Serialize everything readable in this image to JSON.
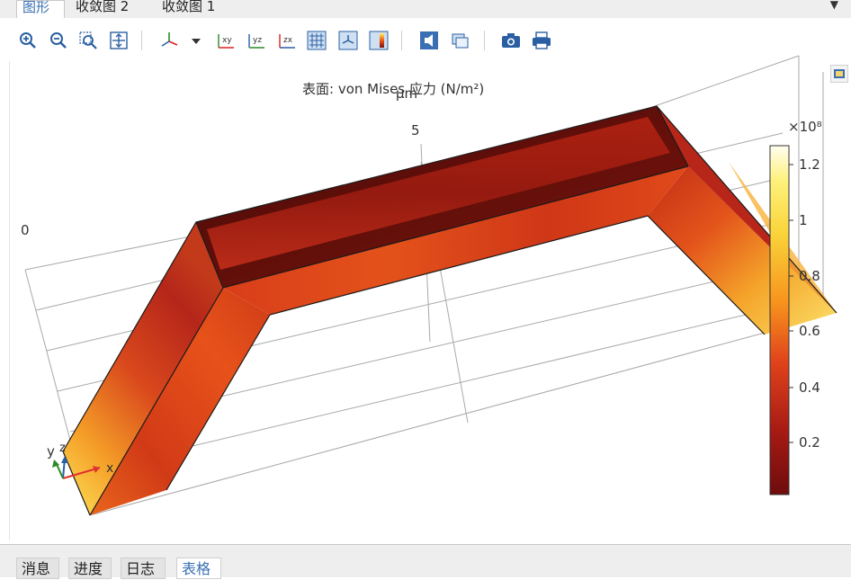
{
  "tabs": [
    {
      "label": "图形",
      "active": true
    },
    {
      "label": "收敛图 2",
      "active": false
    },
    {
      "label": "收敛图 1",
      "active": false
    }
  ],
  "toolbar": {
    "icons": [
      "zoom-in-icon",
      "zoom-out-icon",
      "zoom-box-icon",
      "zoom-extents-icon",
      "axis-orientation-icon",
      "dropdown-arrow-icon",
      "xy-view-icon",
      "yz-view-icon",
      "zx-view-icon",
      "grid-icon",
      "axis-toggle-icon",
      "color-legend-icon",
      "scene-light-icon",
      "transparency-icon",
      "camera-icon",
      "print-icon"
    ]
  },
  "plot": {
    "title": "表面: von Mises 应力 (N/m²)",
    "axis_unit": "μm",
    "axis_ticks": [
      "5",
      "0"
    ],
    "triad": {
      "x": "x",
      "y": "y",
      "z": "z"
    }
  },
  "colorbar": {
    "exponent": "×10⁸",
    "ticks": [
      "1.2",
      "1",
      "0.8",
      "0.6",
      "0.4",
      "0.2"
    ]
  },
  "bottom_tabs": [
    {
      "label": "消息",
      "active": false
    },
    {
      "label": "进度",
      "active": false
    },
    {
      "label": "日志",
      "active": false
    },
    {
      "label": "表格",
      "active": true
    }
  ],
  "colors": {
    "accent": "#3a6fb3"
  }
}
